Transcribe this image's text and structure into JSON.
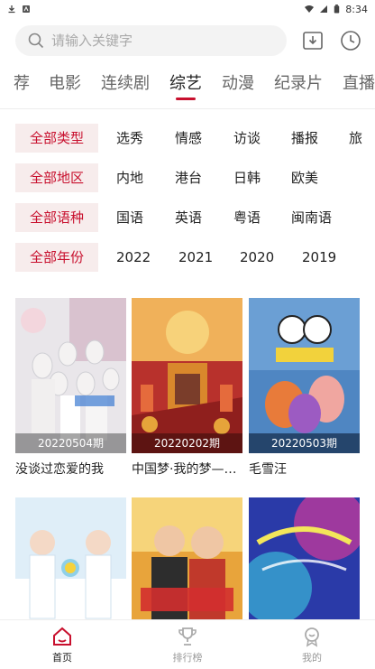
{
  "status_bar": {
    "time": "8:34"
  },
  "search": {
    "placeholder": "请输入关键字"
  },
  "top_icons": [
    "download-icon",
    "history-clock-icon"
  ],
  "tabs": [
    {
      "label": "荐"
    },
    {
      "label": "电影"
    },
    {
      "label": "连续剧"
    },
    {
      "label": "综艺"
    },
    {
      "label": "动漫"
    },
    {
      "label": "纪录片"
    },
    {
      "label": "直播"
    }
  ],
  "active_tab": "综艺",
  "filters": {
    "type": {
      "selected": "全部类型",
      "options": [
        "选秀",
        "情感",
        "访谈",
        "播报",
        "旅"
      ]
    },
    "region": {
      "selected": "全部地区",
      "options": [
        "内地",
        "港台",
        "日韩",
        "欧美"
      ]
    },
    "language": {
      "selected": "全部语种",
      "options": [
        "国语",
        "英语",
        "粤语",
        "闽南语"
      ]
    },
    "year": {
      "selected": "全部年份",
      "options": [
        "2022",
        "2021",
        "2020",
        "2019"
      ]
    }
  },
  "cards": [
    {
      "title": "没谈过恋爱的我",
      "badge": "20220504期"
    },
    {
      "title": "中国梦·我的梦—…",
      "badge": "20220202期"
    },
    {
      "title": "毛雪汪",
      "badge": "20220503期"
    }
  ],
  "cards_row2": [
    {},
    {},
    {}
  ],
  "bottom_nav": [
    {
      "label": "首页"
    },
    {
      "label": "排行榜"
    },
    {
      "label": "我的"
    }
  ],
  "colors": {
    "accent": "#c8102e",
    "chip_bg": "#f7ecec"
  }
}
